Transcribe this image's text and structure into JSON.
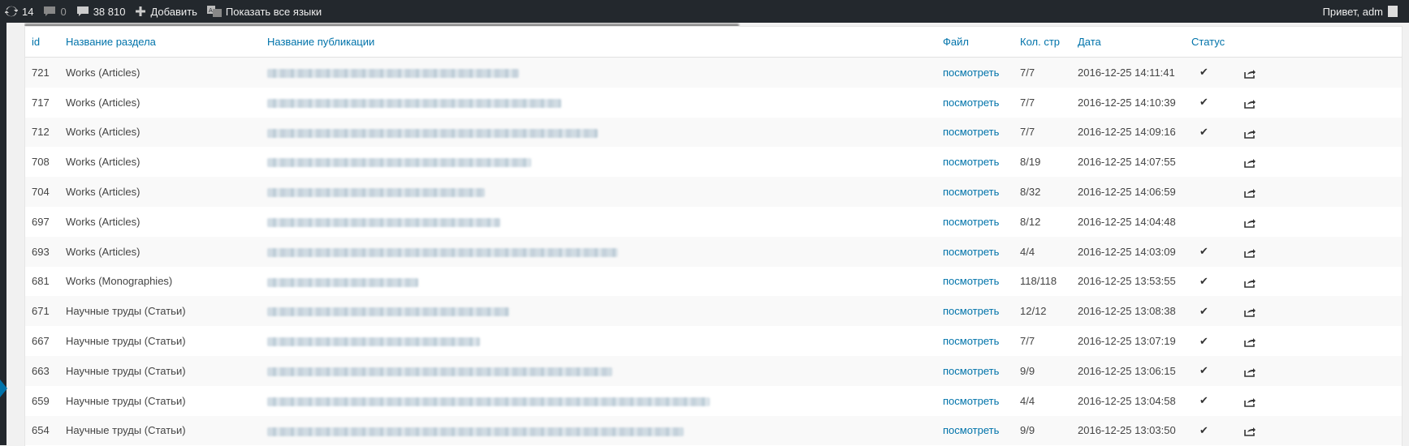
{
  "adminbar": {
    "updates_count": "14",
    "comments_count": "0",
    "reviews_count": "38 810",
    "add_label": "Добавить",
    "languages_label": "Показать все языки",
    "greeting": "Привет, adm"
  },
  "table": {
    "headers": {
      "id": "id",
      "section": "Название раздела",
      "publication": "Название публикации",
      "file": "Файл",
      "pages": "Кол. стр",
      "date": "Дата",
      "status": "Статус"
    },
    "rows": [
      {
        "id": "721",
        "section": "Works (Articles)",
        "file": "посмотреть",
        "pages": "7/7",
        "date": "2016-12-25 14:11:41",
        "status": "✔"
      },
      {
        "id": "717",
        "section": "Works (Articles)",
        "file": "посмотреть",
        "pages": "7/7",
        "date": "2016-12-25 14:10:39",
        "status": "✔"
      },
      {
        "id": "712",
        "section": "Works (Articles)",
        "file": "посмотреть",
        "pages": "7/7",
        "date": "2016-12-25 14:09:16",
        "status": "✔"
      },
      {
        "id": "708",
        "section": "Works (Articles)",
        "file": "посмотреть",
        "pages": "8/19",
        "date": "2016-12-25 14:07:55",
        "status": ""
      },
      {
        "id": "704",
        "section": "Works (Articles)",
        "file": "посмотреть",
        "pages": "8/32",
        "date": "2016-12-25 14:06:59",
        "status": ""
      },
      {
        "id": "697",
        "section": "Works (Articles)",
        "file": "посмотреть",
        "pages": "8/12",
        "date": "2016-12-25 14:04:48",
        "status": ""
      },
      {
        "id": "693",
        "section": "Works (Articles)",
        "file": "посмотреть",
        "pages": "4/4",
        "date": "2016-12-25 14:03:09",
        "status": "✔"
      },
      {
        "id": "681",
        "section": "Works (Monographies)",
        "file": "посмотреть",
        "pages": "118/118",
        "date": "2016-12-25 13:53:55",
        "status": "✔"
      },
      {
        "id": "671",
        "section": "Научные труды (Статьи)",
        "file": "посмотреть",
        "pages": "12/12",
        "date": "2016-12-25 13:08:38",
        "status": "✔"
      },
      {
        "id": "667",
        "section": "Научные труды (Статьи)",
        "file": "посмотреть",
        "pages": "7/7",
        "date": "2016-12-25 13:07:19",
        "status": "✔"
      },
      {
        "id": "663",
        "section": "Научные труды (Статьи)",
        "file": "посмотреть",
        "pages": "9/9",
        "date": "2016-12-25 13:06:15",
        "status": "✔"
      },
      {
        "id": "659",
        "section": "Научные труды (Статьи)",
        "file": "посмотреть",
        "pages": "4/4",
        "date": "2016-12-25 13:04:58",
        "status": "✔"
      },
      {
        "id": "654",
        "section": "Научные труды (Статьи)",
        "file": "посмотреть",
        "pages": "9/9",
        "date": "2016-12-25 13:03:50",
        "status": "✔"
      }
    ]
  }
}
